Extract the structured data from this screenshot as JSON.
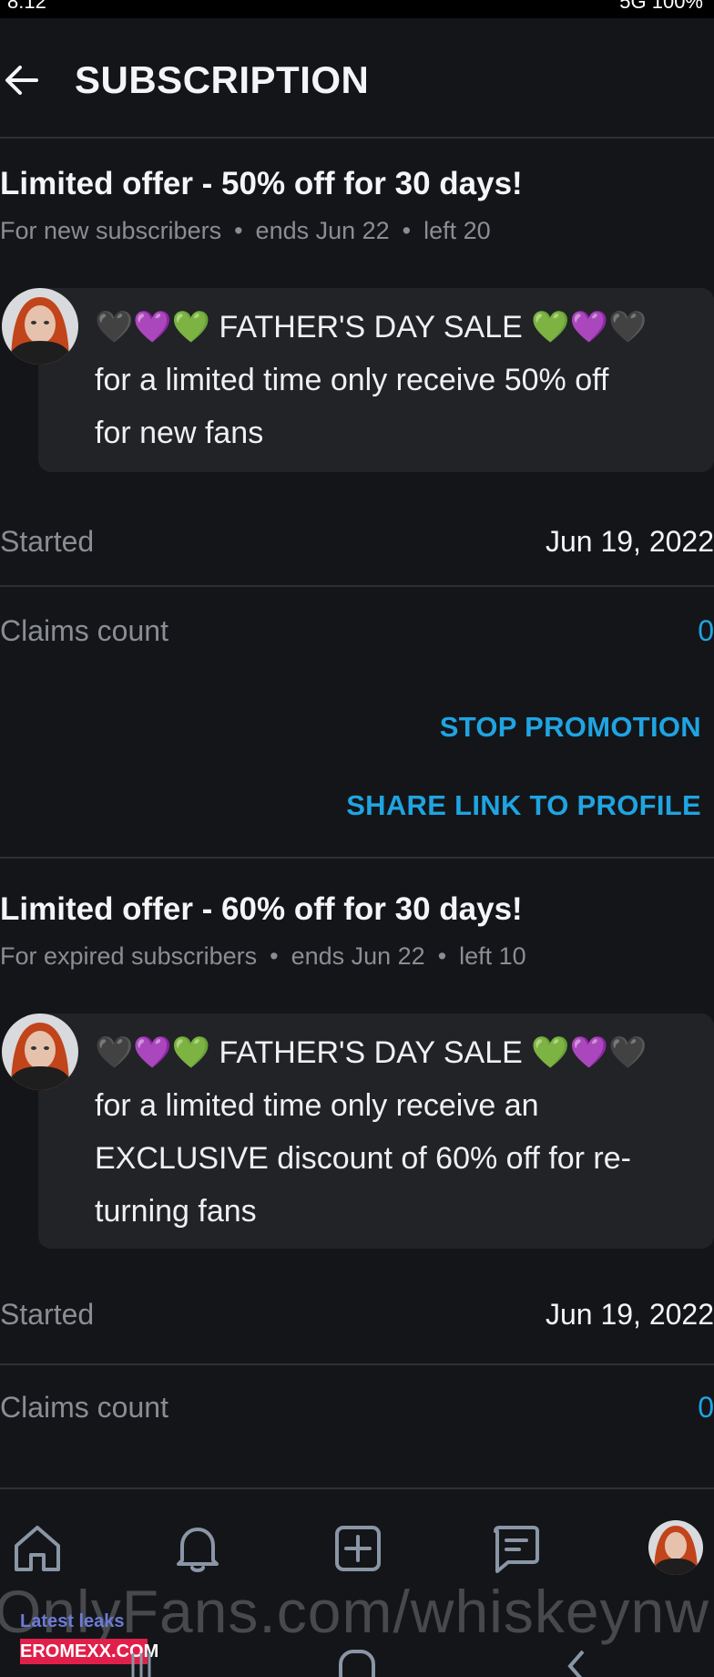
{
  "status_bar": {
    "time": "8:12",
    "right_text": "5G  100%"
  },
  "header": {
    "title": "SUBSCRIPTION"
  },
  "promotions": [
    {
      "title": "Limited offer - 50% off for 30 days!",
      "audience": "For new subscribers",
      "ends": "ends Jun 22",
      "left": "left 20",
      "message_line1": "🖤💜💚 FATHER'S DAY SALE 💚💜🖤",
      "message_line2": "for a limited time only receive 50% off",
      "message_line3": "for new fans",
      "message_line4": "",
      "started_label": "Started",
      "started_value": "Jun 19, 2022",
      "claims_label": "Claims count",
      "claims_value": "0",
      "stop_label": "STOP PROMOTION",
      "share_label": "SHARE LINK TO PROFILE"
    },
    {
      "title": "Limited offer - 60% off for 30 days!",
      "audience": "For expired subscribers",
      "ends": "ends Jun 22",
      "left": "left 10",
      "message_line1": "🖤💜💚 FATHER'S DAY SALE 💚💜🖤",
      "message_line2": "for a limited time only receive an",
      "message_line3": "EXCLUSIVE discount of 60% off for re-",
      "message_line4": "turning fans",
      "started_label": "Started",
      "started_value": "Jun 19, 2022",
      "claims_label": "Claims count",
      "claims_value": "0"
    }
  ],
  "bottom_nav": {
    "items": [
      "home-icon",
      "bell-icon",
      "add-post-icon",
      "messages-icon",
      "profile-avatar"
    ]
  },
  "watermark": {
    "text": "OnlyFans.com/whiskeynw",
    "latest": "Latest leaks",
    "site": "EROMEXX.COM"
  },
  "colors": {
    "background": "#141518",
    "accent": "#1fa4e2",
    "muted": "#8a8d93",
    "bubble": "#212326"
  }
}
